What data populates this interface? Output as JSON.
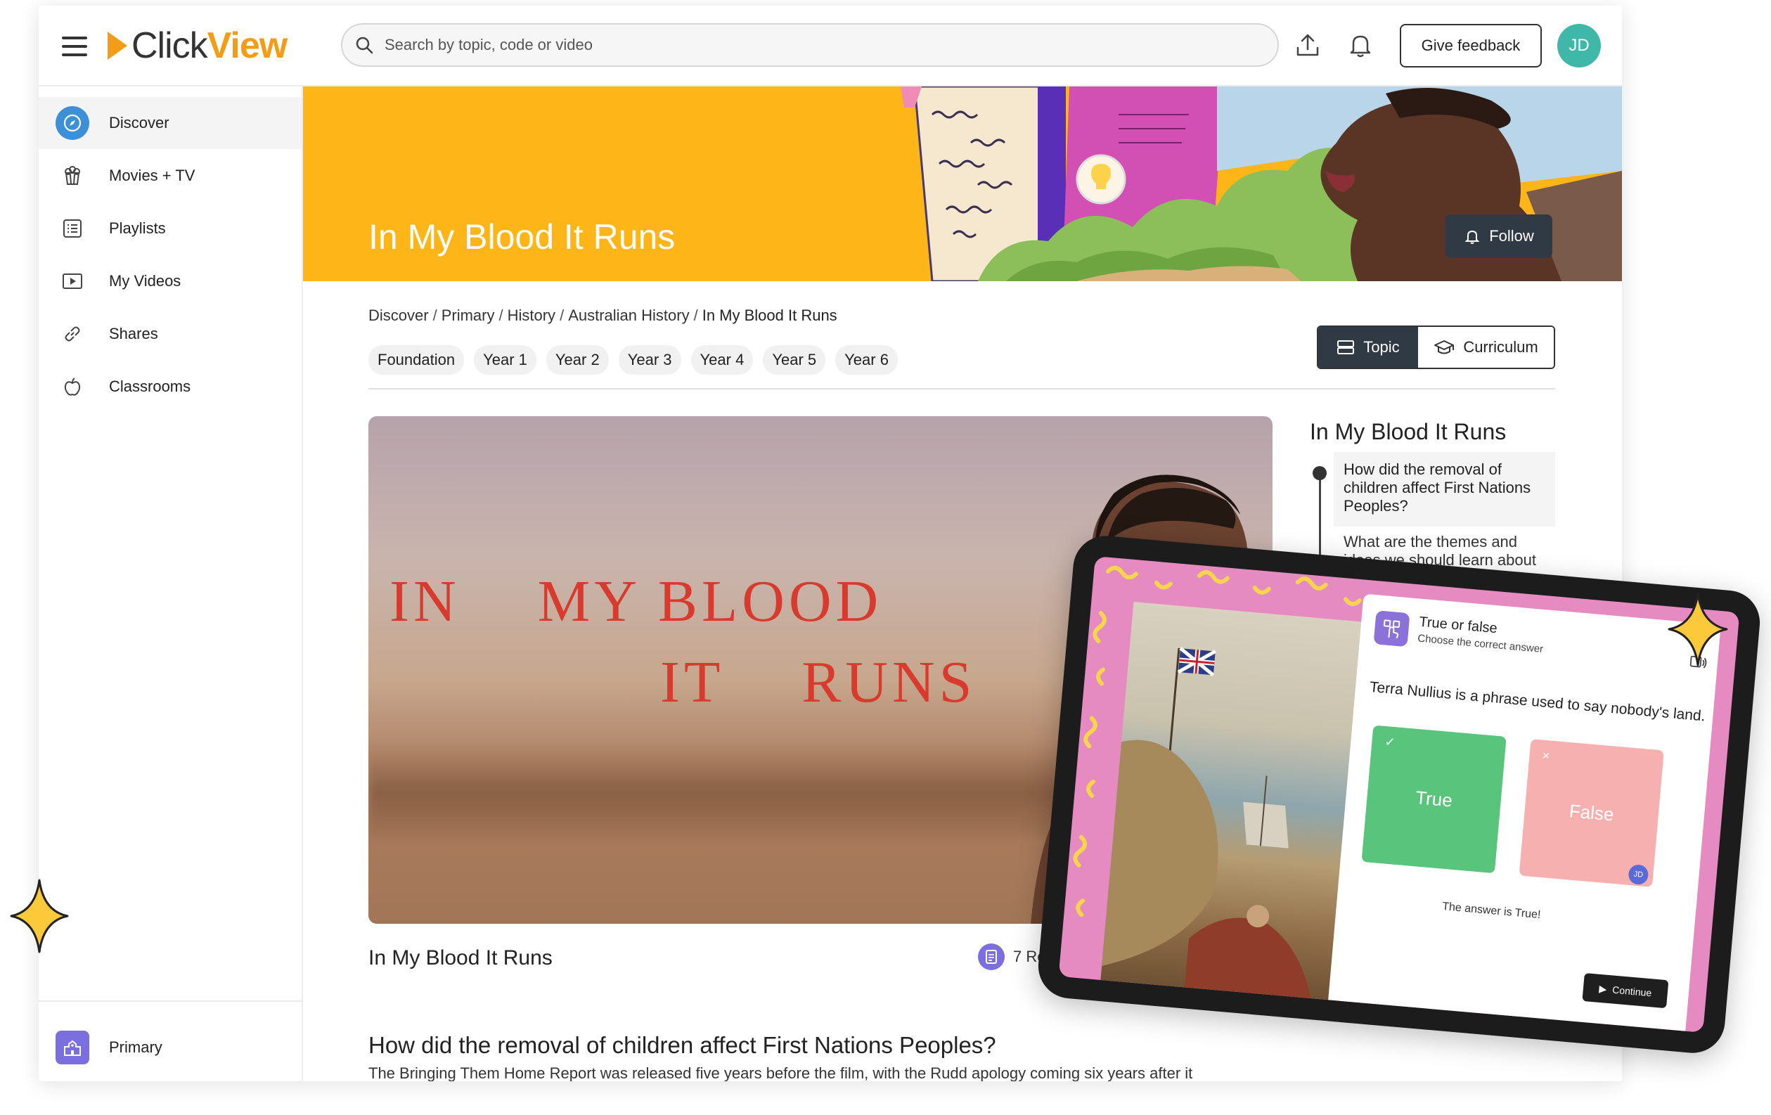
{
  "app": {
    "logo_part1": "Click",
    "logo_part2": "View",
    "search_placeholder": "Search by topic, code or video",
    "feedback_label": "Give feedback",
    "avatar_initials": "JD"
  },
  "sidebar": {
    "items": [
      {
        "label": "Discover",
        "icon": "compass-icon",
        "active": true
      },
      {
        "label": "Movies + TV",
        "icon": "popcorn-icon"
      },
      {
        "label": "Playlists",
        "icon": "list-icon"
      },
      {
        "label": "My Videos",
        "icon": "play-icon"
      },
      {
        "label": "Shares",
        "icon": "link-icon"
      },
      {
        "label": "Classrooms",
        "icon": "apple-icon"
      }
    ],
    "footer_label": "Primary"
  },
  "banner": {
    "title": "In My Blood It Runs",
    "follow_label": "Follow"
  },
  "breadcrumb": {
    "items": [
      "Discover",
      "Primary",
      "History",
      "Australian History"
    ],
    "current": "In My Blood It Runs",
    "separator": "/"
  },
  "years": [
    "Foundation",
    "Year 1",
    "Year 2",
    "Year 3",
    "Year 4",
    "Year 5",
    "Year 6"
  ],
  "view_toggle": {
    "topic_label": "Topic",
    "curriculum_label": "Curriculum"
  },
  "video": {
    "title_line1_a": "IN",
    "title_line1_b": "MY BLOOD",
    "title_line2_a": "IT",
    "title_line2_b": "RUNS",
    "caption": "In My Blood It Runs",
    "resources_label": "7 Reso"
  },
  "section": {
    "heading": "How did the removal of children affect First Nations Peoples?",
    "paragraph": "The Bringing Them Home Report was released five years before the film, with the Rudd apology coming six years after it"
  },
  "toc": {
    "title": "In My Blood It Runs",
    "item1": "How did the removal of children affect First Nations Peoples?",
    "item2": "What are the themes and ideas we should learn about before watching the"
  },
  "quiz": {
    "type_label": "True or false",
    "instruction": "Choose the correct answer",
    "question": "Terra Nullius is a phrase used to say nobody's land.",
    "true_label": "True",
    "false_label": "False",
    "responder_initials": "JD",
    "answer_text": "The answer is True!",
    "continue_label": "Continue"
  },
  "colors": {
    "brand_orange": "#f29d15",
    "banner_yellow": "#fdb517",
    "dark_button": "#2f3a45",
    "avatar_teal": "#3fb8a9",
    "true_green": "#58c47c",
    "false_pink": "#f7b0b0"
  }
}
